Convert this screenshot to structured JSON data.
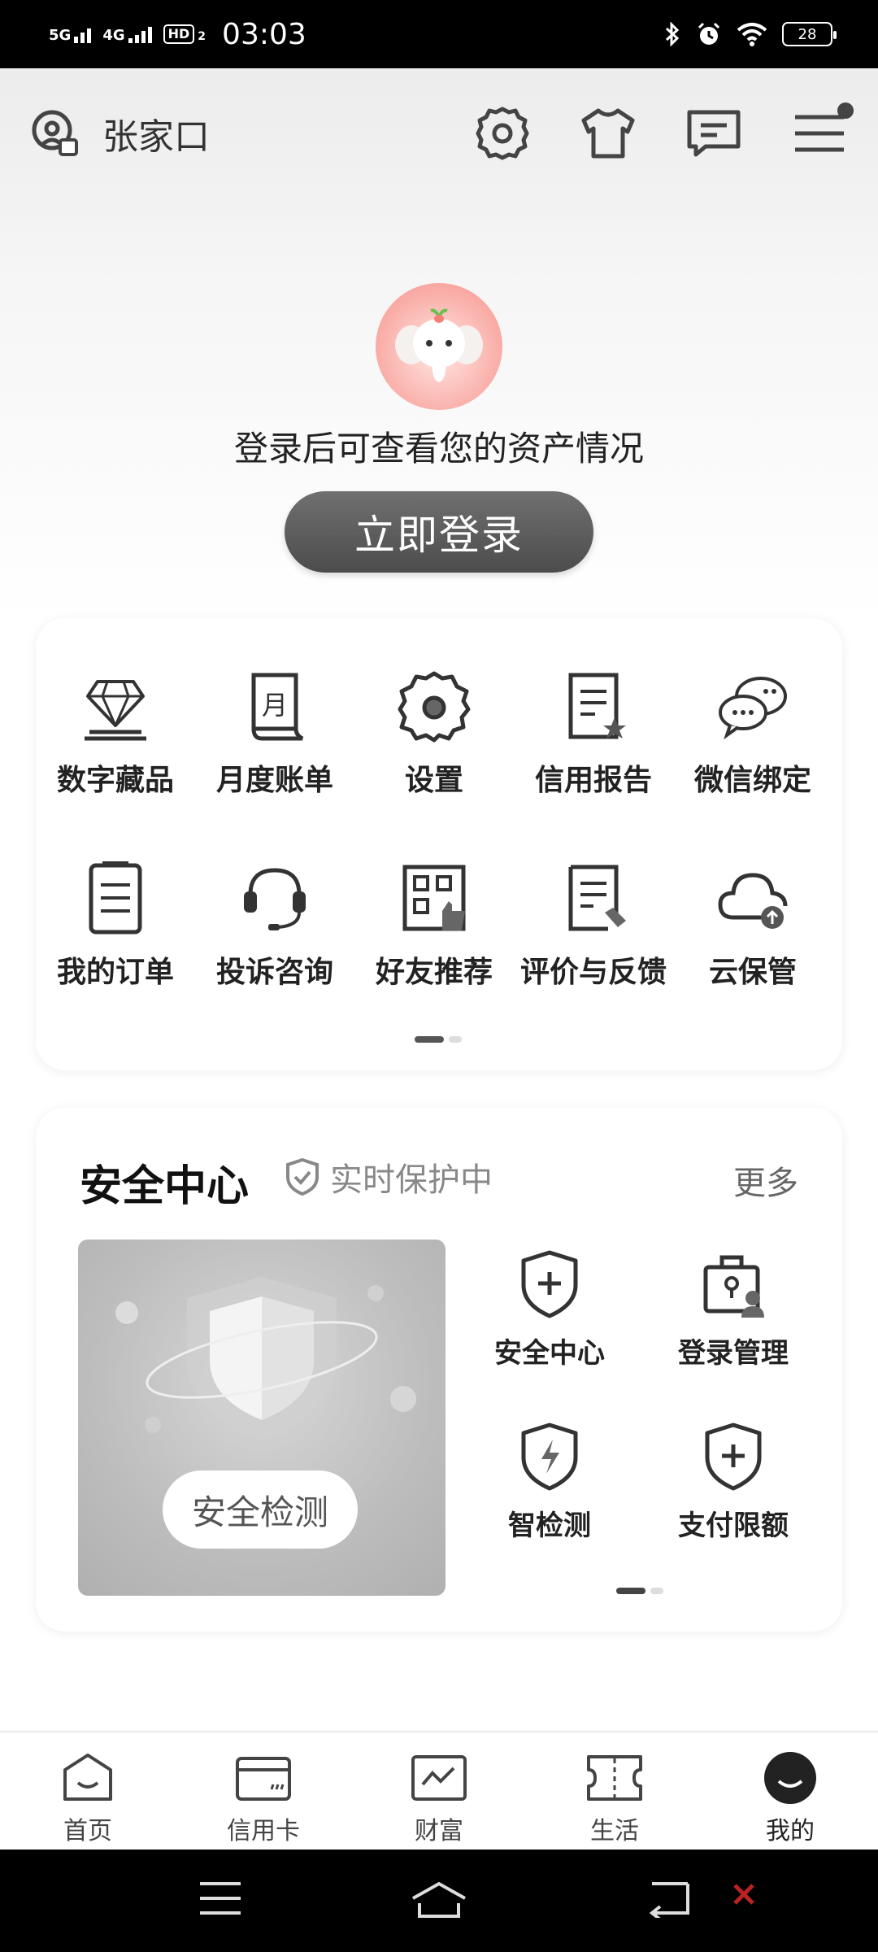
{
  "status_bar": {
    "net1": "5G",
    "net2": "4G",
    "hd": "HD",
    "hd_sub": "2",
    "time": "03:03",
    "battery": "28"
  },
  "header": {
    "city": "张家口"
  },
  "profile": {
    "login_tip": "登录后可查看您的资产情况",
    "login_button": "立即登录"
  },
  "quick_grid": {
    "items": [
      {
        "label": "数字藏品",
        "icon": "diamond-icon"
      },
      {
        "label": "月度账单",
        "icon": "monthly-bill-icon"
      },
      {
        "label": "设置",
        "icon": "gear-icon"
      },
      {
        "label": "信用报告",
        "icon": "credit-report-icon"
      },
      {
        "label": "微信绑定",
        "icon": "wechat-chat-icon"
      },
      {
        "label": "我的订单",
        "icon": "order-list-icon"
      },
      {
        "label": "投诉咨询",
        "icon": "headset-icon"
      },
      {
        "label": "好友推荐",
        "icon": "qr-thumb-icon"
      },
      {
        "label": "评价与反馈",
        "icon": "feedback-doc-icon"
      },
      {
        "label": "云保管",
        "icon": "cloud-upload-icon"
      }
    ]
  },
  "security": {
    "title": "安全中心",
    "status": "实时保护中",
    "more": "更多",
    "check_button": "安全检测",
    "items": [
      {
        "label": "安全中心",
        "icon": "shield-plus-icon"
      },
      {
        "label": "登录管理",
        "icon": "lock-user-icon"
      },
      {
        "label": "智检测",
        "icon": "shield-bolt-icon"
      },
      {
        "label": "支付限额",
        "icon": "shield-plus-icon"
      }
    ]
  },
  "tab_bar": {
    "tabs": [
      {
        "label": "首页",
        "icon": "home-icon"
      },
      {
        "label": "信用卡",
        "icon": "credit-card-icon"
      },
      {
        "label": "财富",
        "icon": "wealth-chart-icon"
      },
      {
        "label": "生活",
        "icon": "ticket-icon"
      },
      {
        "label": "我的",
        "icon": "profile-icon"
      }
    ]
  }
}
